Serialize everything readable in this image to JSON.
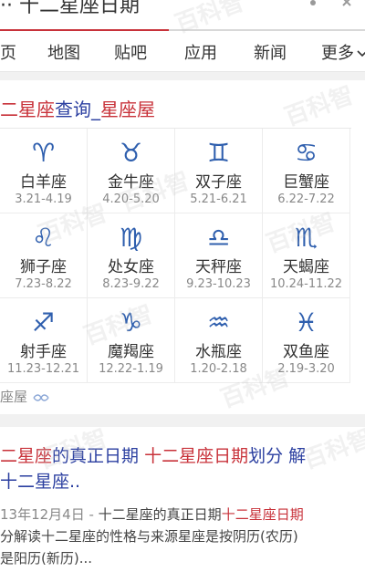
{
  "search": {
    "query": "·· 十二星座日期"
  },
  "nav": {
    "tabs": [
      {
        "label": "页"
      },
      {
        "label": "地图"
      },
      {
        "label": "贴吧"
      },
      {
        "label": "应用"
      },
      {
        "label": "新闻"
      },
      {
        "label": "更多"
      }
    ]
  },
  "card": {
    "title_part1": "二星座",
    "title_part2": "查询_",
    "title_part3": "星座屋",
    "signs": [
      {
        "name": "白羊座",
        "date": "3.21-4.19",
        "symbol": "♈"
      },
      {
        "name": "金牛座",
        "date": "4.20-5.20",
        "symbol": "♉"
      },
      {
        "name": "双子座",
        "date": "5.21-6.21",
        "symbol": "♊"
      },
      {
        "name": "巨蟹座",
        "date": "6.22-7.22",
        "symbol": "♋"
      },
      {
        "name": "狮子座",
        "date": "7.23-8.22",
        "symbol": "♌"
      },
      {
        "name": "处女座",
        "date": "8.23-9.22",
        "symbol": "♍"
      },
      {
        "name": "天秤座",
        "date": "9.23-10.23",
        "symbol": "♎"
      },
      {
        "name": "天蝎座",
        "date": "10.24-11.22",
        "symbol": "♏"
      },
      {
        "name": "射手座",
        "date": "11.23-12.21",
        "symbol": "♐"
      },
      {
        "name": "魔羯座",
        "date": "12.22-1.19",
        "symbol": "♑"
      },
      {
        "name": "水瓶座",
        "date": "1.20-2.18",
        "symbol": "♒"
      },
      {
        "name": "双鱼座",
        "date": "2.19-3.20",
        "symbol": "♓"
      }
    ],
    "source": "座屋"
  },
  "result2": {
    "title_a": "二星座",
    "title_b": "的真正日期 ",
    "title_c": "十二星座日期",
    "title_d": "划分 解",
    "title_e": "十二星座..",
    "snippet_date": "13年12月4日 - ",
    "snippet_a": "十二星座的真正日期",
    "snippet_b": "十二星座日期",
    "snippet_c": "分解读十二星座的性格与来源星座是按阴历(农历)",
    "snippet_d": "是阳历(新历)..."
  },
  "watermark": "百科智",
  "colors": {
    "accent_red": "#c8323a",
    "link_blue": "#2b3fa0",
    "symbol_blue": "#2f5fae"
  }
}
